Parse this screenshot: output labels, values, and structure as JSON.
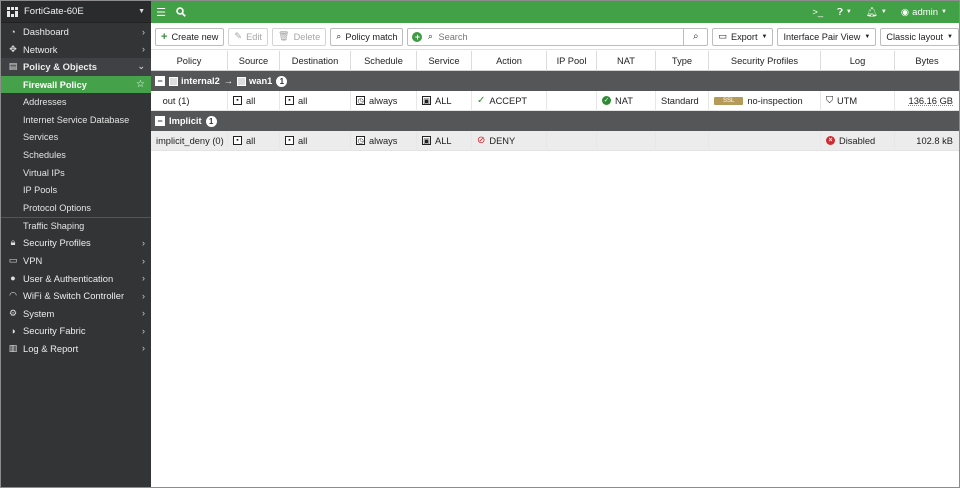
{
  "device": {
    "name": "FortiGate-60E"
  },
  "nav": {
    "dashboard": "Dashboard",
    "network": "Network",
    "policy_objects": "Policy & Objects",
    "sub_items": [
      "Firewall Policy",
      "Addresses",
      "Internet Service Database",
      "Services",
      "Schedules",
      "Virtual IPs",
      "IP Pools",
      "Protocol Options",
      "Traffic Shaping"
    ],
    "security_profiles": "Security Profiles",
    "vpn": "VPN",
    "user_auth": "User & Authentication",
    "wifi_switch": "WiFi & Switch Controller",
    "system": "System",
    "security_fabric": "Security Fabric",
    "log_report": "Log & Report"
  },
  "topbar": {
    "user": "admin"
  },
  "toolbar": {
    "create_new": "Create new",
    "edit": "Edit",
    "delete": "Delete",
    "policy_match": "Policy match",
    "search_placeholder": "Search",
    "export": "Export",
    "interface_pair_view": "Interface Pair View",
    "classic_layout": "Classic layout"
  },
  "table": {
    "columns": [
      "Policy",
      "Source",
      "Destination",
      "Schedule",
      "Service",
      "Action",
      "IP Pool",
      "NAT",
      "Type",
      "Security Profiles",
      "Log",
      "Bytes"
    ],
    "groups": [
      {
        "from": "internal2",
        "arrow": "→",
        "to": "wan1",
        "count": "1",
        "rows": [
          {
            "policy": "out (1)",
            "source": "all",
            "destination": "all",
            "schedule": "always",
            "service": "ALL",
            "action": "ACCEPT",
            "ip_pool": "",
            "nat": "NAT",
            "type": "Standard",
            "sec_badge": "SSL",
            "security_profiles": "no-inspection",
            "log": "UTM",
            "bytes": "136.16 GB"
          }
        ]
      },
      {
        "title": "Implicit",
        "count": "1",
        "rows": [
          {
            "policy": "implicit_deny (0)",
            "source": "all",
            "destination": "all",
            "schedule": "always",
            "service": "ALL",
            "action": "DENY",
            "log": "Disabled",
            "bytes": "102.8 kB"
          }
        ]
      }
    ]
  },
  "colors": {
    "accent_green": "#42a046",
    "sidebar_bg": "#333436",
    "deny_red": "#d0242c",
    "ssl_badge": "#b59a5a"
  }
}
